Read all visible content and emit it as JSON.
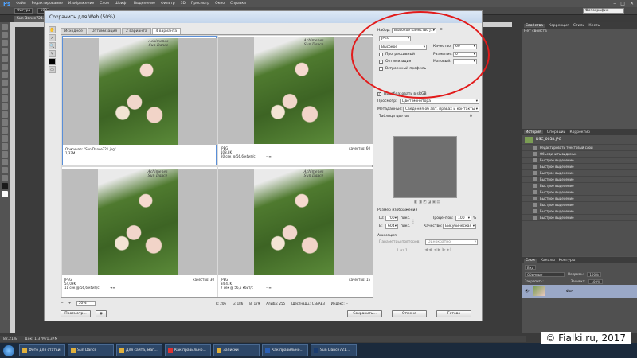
{
  "ps": {
    "logo": "Ps",
    "menu": [
      "Файл",
      "Редактирование",
      "Изображение",
      "Слои",
      "Шрифт",
      "Выделение",
      "Фильтр",
      "3D",
      "Просмотр",
      "Окно",
      "Справка"
    ],
    "window_controls": [
      "–",
      "□",
      "✕"
    ],
    "options": {
      "shape": "Фигура",
      "px": "100"
    },
    "workspace": "Фотография",
    "doc_tab": "Sun Dance721.jp..."
  },
  "panels": {
    "top_tabs": [
      "Свойства",
      "Коррекция",
      "Стили",
      "Кисть"
    ],
    "props_text": "Нет свойств",
    "history_tabs": [
      "История",
      "Операции",
      "Корректир"
    ],
    "history_snapshot": "DSC_0058.JPG",
    "history": [
      "Редактировать текстовый слой",
      "Объединить видимые",
      "Быстрое выделение",
      "Быстрое выделение",
      "Быстрое выделение",
      "Быстрое выделение",
      "Быстрое выделение",
      "Быстрое выделение",
      "Быстрое выделение",
      "Быстрое выделение",
      "Быстрое выделение",
      "Быстрое выделение"
    ],
    "layers_tabs": [
      "Слои",
      "Каналы",
      "Контуры"
    ],
    "layers_kind": "Вид",
    "layers_mode": "Обычные",
    "layers_opacity_label": "Непрозр.:",
    "layers_opacity": "100%",
    "layers_lock": "Закрепить:",
    "layers_fill_label": "Заливка:",
    "layers_fill": "100%",
    "layer_name": "Фон"
  },
  "status": {
    "zoom": "82,21%",
    "doc": "Док: 1,37M/1,37M"
  },
  "taskbar": [
    "Фото для статьи",
    "Sun Dance",
    "Для сайта, маг...",
    "Как правильно...",
    "Записки",
    "Как правильно...",
    "Sun Dance721..."
  ],
  "watermark": "© Fialki.ru, 2017",
  "dialog": {
    "title": "Сохранить для Web (50%)",
    "view_tabs": [
      "Исходное",
      "Оптимизация",
      "2 варианта",
      "4 варианта"
    ],
    "signature": "Achimenes\nSun Dance",
    "panes": [
      {
        "left": "Оригинал: \"Sun Dance721.jpg\"\n1,37M",
        "right": ""
      },
      {
        "left": "JPEG\n108,8K\n20 сек @ 56,6 кбит/с",
        "arrow": "→≡",
        "right": "качество: 60"
      },
      {
        "left": "JPEG\n54,09K\n11 сек @ 56,6 кбит/с",
        "arrow": "→≡",
        "right": "качество: 30"
      },
      {
        "left": "JPEG\n34,47K\n7 сек @ 56,6 кбит/с",
        "arrow": "→≡",
        "right": "качество: 15"
      }
    ],
    "zoom": "50%",
    "readout": [
      "R: 206",
      "G: 186",
      "B: 179",
      "Альфа: 255",
      "Шестнадц.: CEBAB3",
      "Индекс: --"
    ],
    "buttons": {
      "preview": "Просмотр...",
      "save": "Сохранить...",
      "cancel": "Отмена",
      "done": "Готово"
    },
    "settings": {
      "preset_label": "Набор:",
      "preset": "Высокое качество J...",
      "format": "JPEG",
      "quality_preset": "Высокое",
      "quality_label": "Качество:",
      "quality": "60",
      "progressive": "Прогрессивный",
      "blur_label": "Размытие:",
      "blur": "0",
      "optimized": "Оптимизация",
      "matte_label": "Матовый:",
      "icc": "Встроенный профиль",
      "convert_srgb": "Преобразовать в sRGB",
      "preview_label": "Просмотр:",
      "preview_value": "Цвет монитора",
      "metadata_label": "Метаданные:",
      "metadata_value": "Сведения об авт. правах и контакты",
      "color_table": "Таблица цветов",
      "color_count": "0",
      "image_size": "Размер изображения",
      "w_label": "Ш:",
      "w": "700",
      "px": "пикс.",
      "h_label": "В:",
      "h": "604",
      "percent_label": "Процентов:",
      "percent": "100",
      "pct_sign": "%",
      "quality2_label": "Качество:",
      "quality2": "Бикубическая",
      "animation": "Анимация",
      "loop_label": "Параметры повторов:",
      "loop": "Однократно",
      "frame": "1 из 1"
    }
  }
}
